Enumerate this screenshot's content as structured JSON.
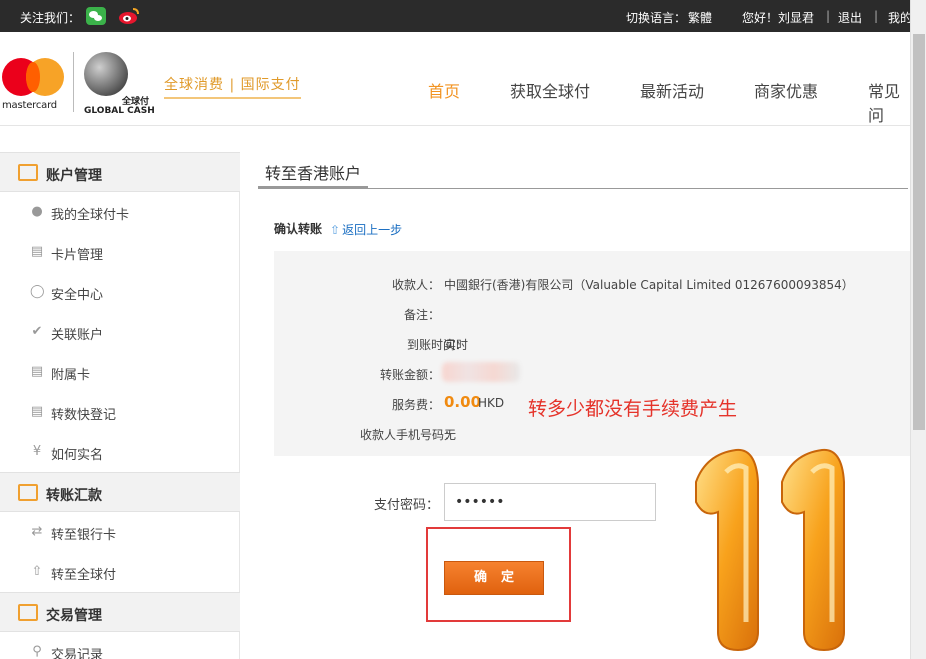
{
  "topbar": {
    "follow_label": "关注我们：",
    "lang_label": "切换语言：",
    "lang_value": "繁體",
    "greeting": "您好！刘显君",
    "sep": "|",
    "logout": "退出",
    "mine": "我的"
  },
  "header": {
    "mastercard_text": "mastercard",
    "brand_cn": "全球付",
    "brand_en": "GLOBAL CASH",
    "slogan": "全球消费 | 国际支付",
    "nav": [
      "首页",
      "获取全球付",
      "最新活动",
      "商家优惠",
      "常见问"
    ]
  },
  "sidebar": {
    "sections": [
      {
        "label": "账户管理",
        "icon": "card-icon"
      },
      {
        "label": "转账汇款",
        "icon": "transfer-icon"
      },
      {
        "label": "交易管理",
        "icon": "chart-icon"
      }
    ],
    "items": [
      {
        "label": "我的全球付卡",
        "icon": "user-icon"
      },
      {
        "label": "卡片管理",
        "icon": "card-icon"
      },
      {
        "label": "安全中心",
        "icon": "shield-icon"
      },
      {
        "label": "关联账户",
        "icon": "check-icon"
      },
      {
        "label": "附属卡",
        "icon": "card-icon"
      },
      {
        "label": "转数快登记",
        "icon": "document-icon"
      },
      {
        "label": "如何实名",
        "icon": "shield-yen-icon"
      },
      {
        "label": "转至银行卡",
        "icon": "swap-icon"
      },
      {
        "label": "转至全球付",
        "icon": "upload-icon"
      },
      {
        "label": "交易记录",
        "icon": "search-icon"
      }
    ]
  },
  "main": {
    "title": "转至香港账户",
    "confirm_label": "确认转账",
    "back_link": "返回上一步",
    "rows": [
      {
        "label": "收款人：",
        "value": "中國銀行(香港)有限公司（Valuable Capital Limited 01267600093854）"
      },
      {
        "label": "备注：",
        "value": ""
      },
      {
        "label": "到账时间：",
        "value": "实时"
      },
      {
        "label": "转账金额：",
        "value": ""
      },
      {
        "label": "服务费：",
        "value": ""
      },
      {
        "label": "收款人手机号码：",
        "value": "无"
      }
    ],
    "fee_value": "0.00",
    "fee_unit": "HKD",
    "annotation": "转多少都没有手续费产生",
    "password_label": "支付密码：",
    "password_value": "••••••",
    "confirm_button": "确定"
  },
  "colors": {
    "accent": "#f29423",
    "annotation_red": "#e5332a",
    "button_orange": "#e8681a",
    "link_blue": "#1a6ec2"
  }
}
